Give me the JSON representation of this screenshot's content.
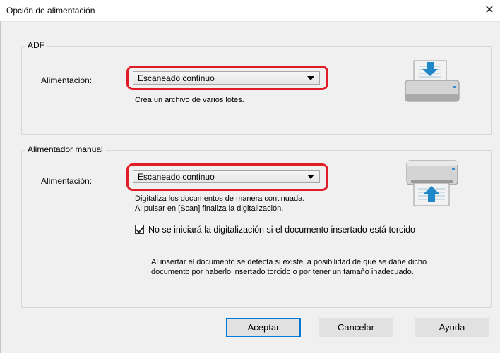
{
  "window": {
    "title": "Opción de alimentación",
    "close_icon": "close-icon"
  },
  "adf": {
    "group_label": "ADF",
    "feed_label": "Alimentación:",
    "feed_value": "Escaneado continuo",
    "description": "Crea un archivo de varios lotes.",
    "icon": "scanner-adf-icon"
  },
  "manual": {
    "group_label": "Alimentador manual",
    "feed_label": "Alimentación:",
    "feed_value": "Escaneado continuo",
    "description_line1": "Digitaliza los documentos de manera continuada.",
    "description_line2": "Al pulsar en [Scan] finaliza la digitalización.",
    "icon": "scanner-manual-icon",
    "skew_checkbox_label": "No se iniciará la digitalización si el documento insertado está torcido",
    "skew_checkbox_checked": true,
    "note_line1": "Al insertar el documento se detecta si existe la posibilidad de que se dañe dicho",
    "note_line2": "documento por haberlo insertado torcido o por tener un tamaño inadecuado."
  },
  "buttons": {
    "ok": "Aceptar",
    "cancel": "Cancelar",
    "help": "Ayuda"
  },
  "colors": {
    "highlight": "#e01c27",
    "default_button_border": "#0078d7",
    "arrow_blue": "#1e88c8"
  }
}
